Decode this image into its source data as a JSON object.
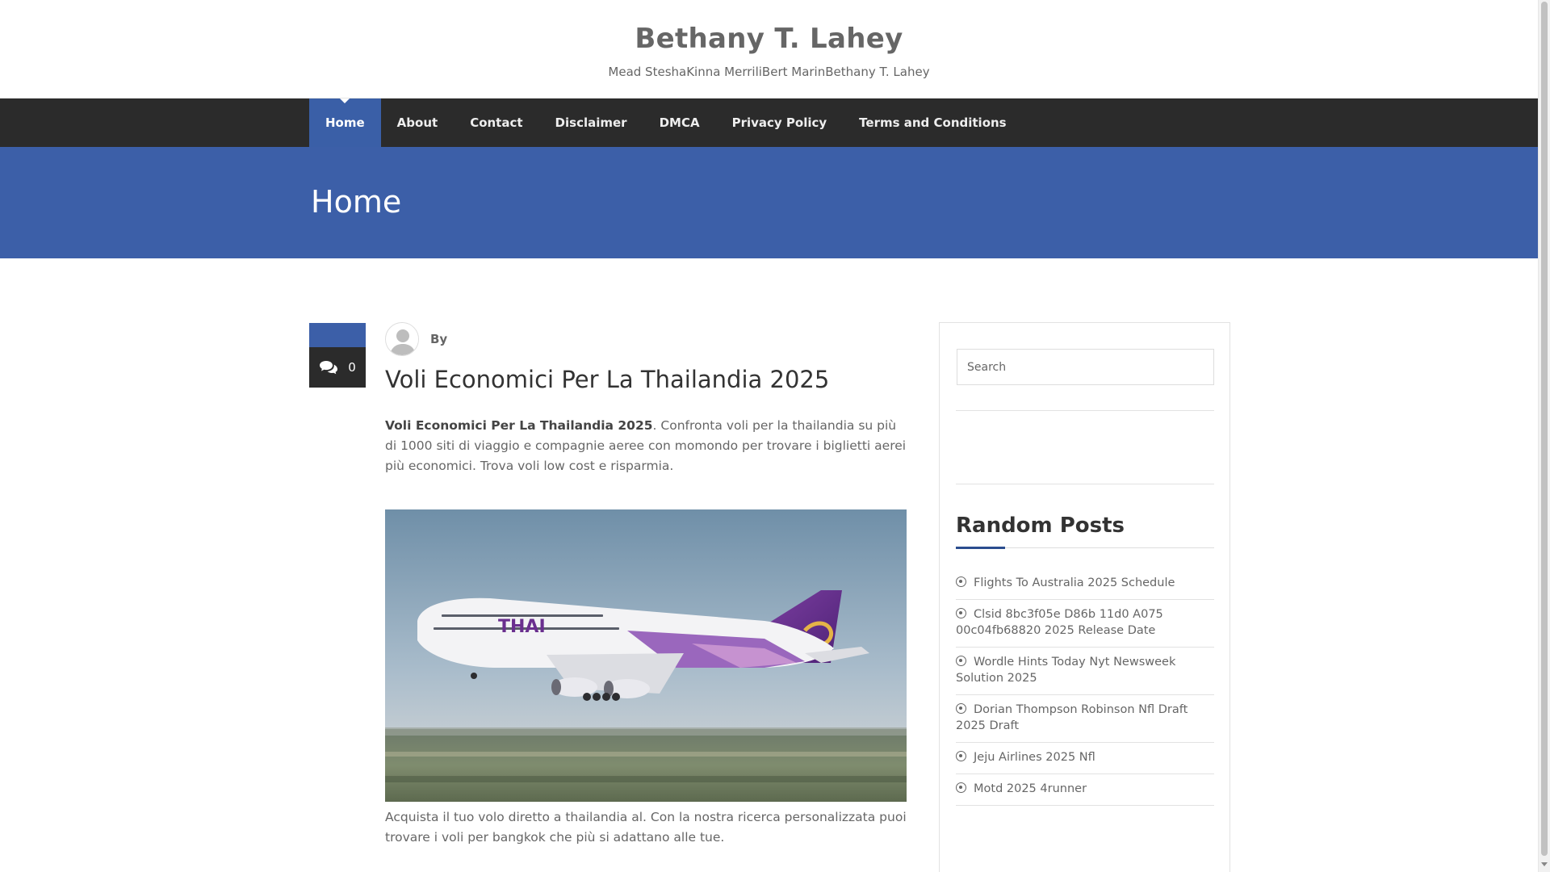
{
  "header": {
    "site_title": "Bethany T. Lahey",
    "site_description": "Mead SteshaKinna MerriliBert MarinBethany T. Lahey"
  },
  "nav": {
    "items": [
      "Home",
      "About",
      "Contact",
      "Disclaimer",
      "DMCA",
      "Privacy Policy",
      "Terms and Conditions"
    ],
    "active": "Home"
  },
  "banner": {
    "heading": "Home"
  },
  "post": {
    "comment_count": "0",
    "by_label": "By",
    "title": "Voli Economici Per La Thailandia 2025",
    "intro_bold": "Voli Economici Per La Thailandia 2025",
    "intro_rest": ". Confronta voli per la thailandia su più di 1000 siti di viaggio e compagnie aeree con momondo per trovare i biglietti aerei più economici. Trova voli low cost e risparmia.",
    "image_text": "THAI",
    "after_image": "Acquista il tuo volo diretto a thailandia al. Con la nostra ricerca personalizzata puoi trovare i voli per bangkok che più si adattano alle tue."
  },
  "sidebar": {
    "search_placeholder": "Search",
    "random_posts_title": "Random Posts",
    "random_posts": [
      "Flights To Australia 2025 Schedule",
      "Clsid 8bc3f05e D86b 11d0 A075 00c04fb68820 2025 Release Date",
      "Wordle Hints Today Nyt Newsweek Solution 2025",
      "Dorian Thompson Robinson Nfl Draft 2025 Draft",
      "Jeju Airlines 2025 Nfl",
      "Motd 2025 4runner"
    ]
  },
  "colors": {
    "accent_blue": "#3c5fa8",
    "nav_dark": "#2b2b2b"
  }
}
